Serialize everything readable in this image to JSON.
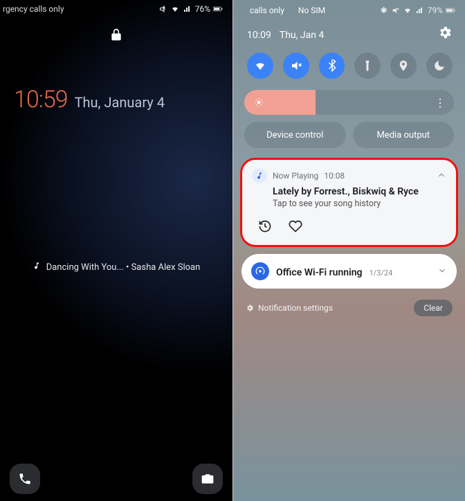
{
  "left": {
    "status_left": "rgency calls only",
    "battery": "76%",
    "clock": "10:59",
    "date": "Thu, January 4",
    "song": "Dancing With You... • Sasha Alex Sloan"
  },
  "right": {
    "status_calls": "calls only",
    "status_sim": "No SIM",
    "battery": "79%",
    "time": "10:09",
    "date": "Thu, Jan 4",
    "device_control": "Device control",
    "media_output": "Media output",
    "np": {
      "app": "Now Playing",
      "time": "10:08",
      "title": "Lately by Forrest., Biskwiq & Ryce",
      "sub": "Tap to see your song history"
    },
    "wifi": {
      "title": "Office Wi-Fi running",
      "date": "1/3/24"
    },
    "settings_label": "Notification settings",
    "clear_label": "Clear"
  }
}
